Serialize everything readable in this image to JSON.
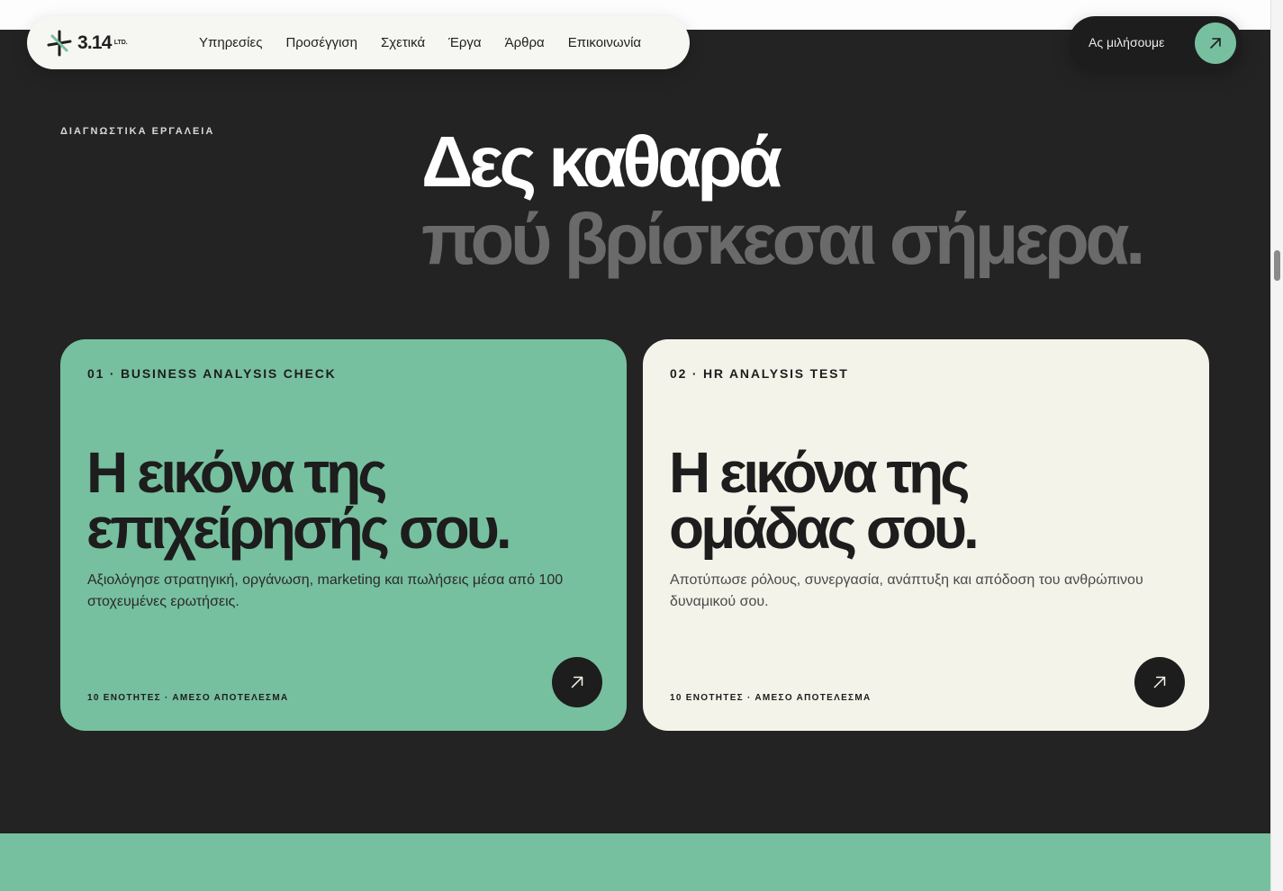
{
  "brand": {
    "name": "3.14",
    "suffix": "LTD.",
    "accent_color": "#77c09f",
    "dark_color": "#232323",
    "cream_color": "#f4f3ea"
  },
  "nav": {
    "links": [
      "Υπηρεσίες",
      "Προσέγγιση",
      "Σχετικά",
      "Έργα",
      "Άρθρα",
      "Επικοινωνία"
    ]
  },
  "cta": {
    "label": "Ας μιλήσουμε",
    "icon": "arrow-up-right-icon"
  },
  "section": {
    "eyebrow": "ΔΙΑΓΝΩΣΤΙΚΑ ΕΡΓΑΛΕΙΑ",
    "headline_line1": "Δες καθαρά",
    "headline_line2": "πού βρίσκεσαι σήμερα."
  },
  "cards": [
    {
      "tag": "01 · BUSINESS ANALYSIS CHECK",
      "title_line1": "Η εικόνα της",
      "title_line2": "επιχείρησής σου.",
      "description": "Αξιολόγησε στρατηγική, οργάνωση, marketing και πωλήσεις μέσα από 100 στοχευμένες ερωτήσεις.",
      "meta": "10 ΕΝΟΤΗΤΕΣ · ΑΜΕΣΟ ΑΠΟΤΕΛΕΣΜΑ",
      "icon": "arrow-up-right-icon"
    },
    {
      "tag": "02 · HR ANALYSIS TEST",
      "title_line1": "Η εικόνα της",
      "title_line2": "ομάδας σου.",
      "description": "Αποτύπωσε ρόλους, συνεργασία, ανάπτυξη και απόδοση του ανθρώπινου δυναμικού σου.",
      "meta": "10 ΕΝΟΤΗΤΕΣ · ΑΜΕΣΟ ΑΠΟΤΕΛΕΣΜΑ",
      "icon": "arrow-up-right-icon"
    }
  ]
}
